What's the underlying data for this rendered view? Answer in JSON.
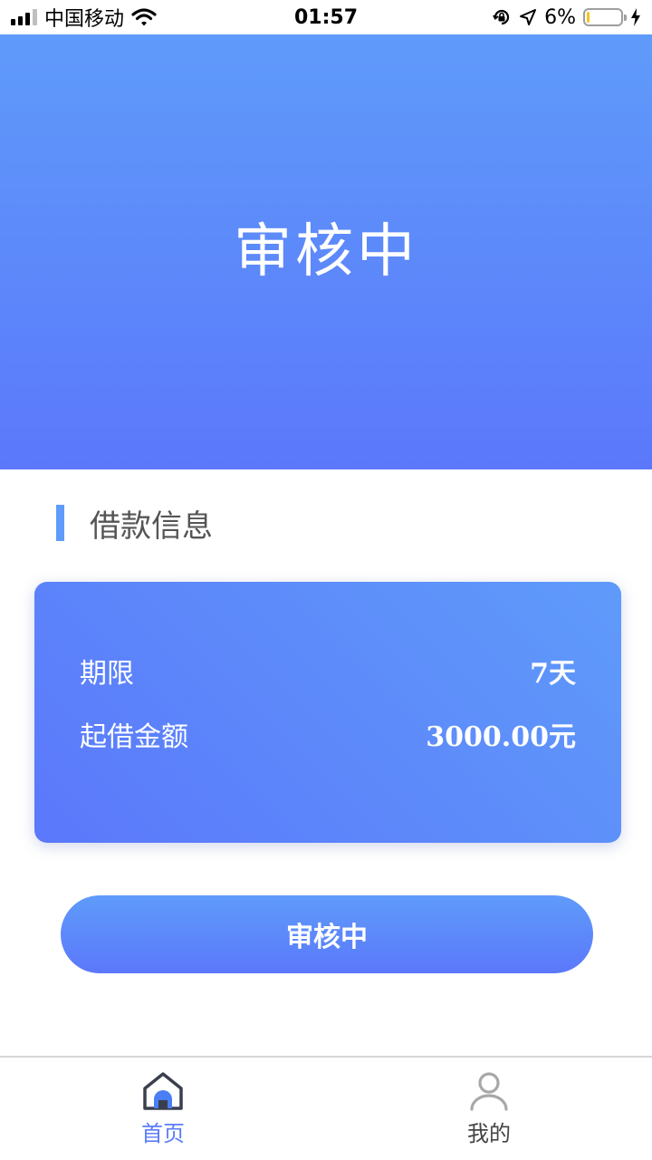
{
  "status_bar": {
    "carrier": "中国移动",
    "time": "01:57",
    "battery_percent": "6%",
    "battery_level": 0.06
  },
  "hero": {
    "title": "审核中"
  },
  "section": {
    "title": "借款信息"
  },
  "loan_info": {
    "rows": [
      {
        "label": "期限",
        "value": "7天"
      },
      {
        "label": "起借金额",
        "value": "3000.00元"
      }
    ]
  },
  "action": {
    "label": "审核中"
  },
  "tab_bar": {
    "items": [
      {
        "label": "首页",
        "icon": "home-icon",
        "active": true
      },
      {
        "label": "我的",
        "icon": "user-icon",
        "active": false
      }
    ]
  },
  "colors": {
    "accent": "#5b78fb",
    "accent_light": "#5f9bfa",
    "tab_active": "#5b7cfa",
    "battery_fill": "#f5c518"
  }
}
